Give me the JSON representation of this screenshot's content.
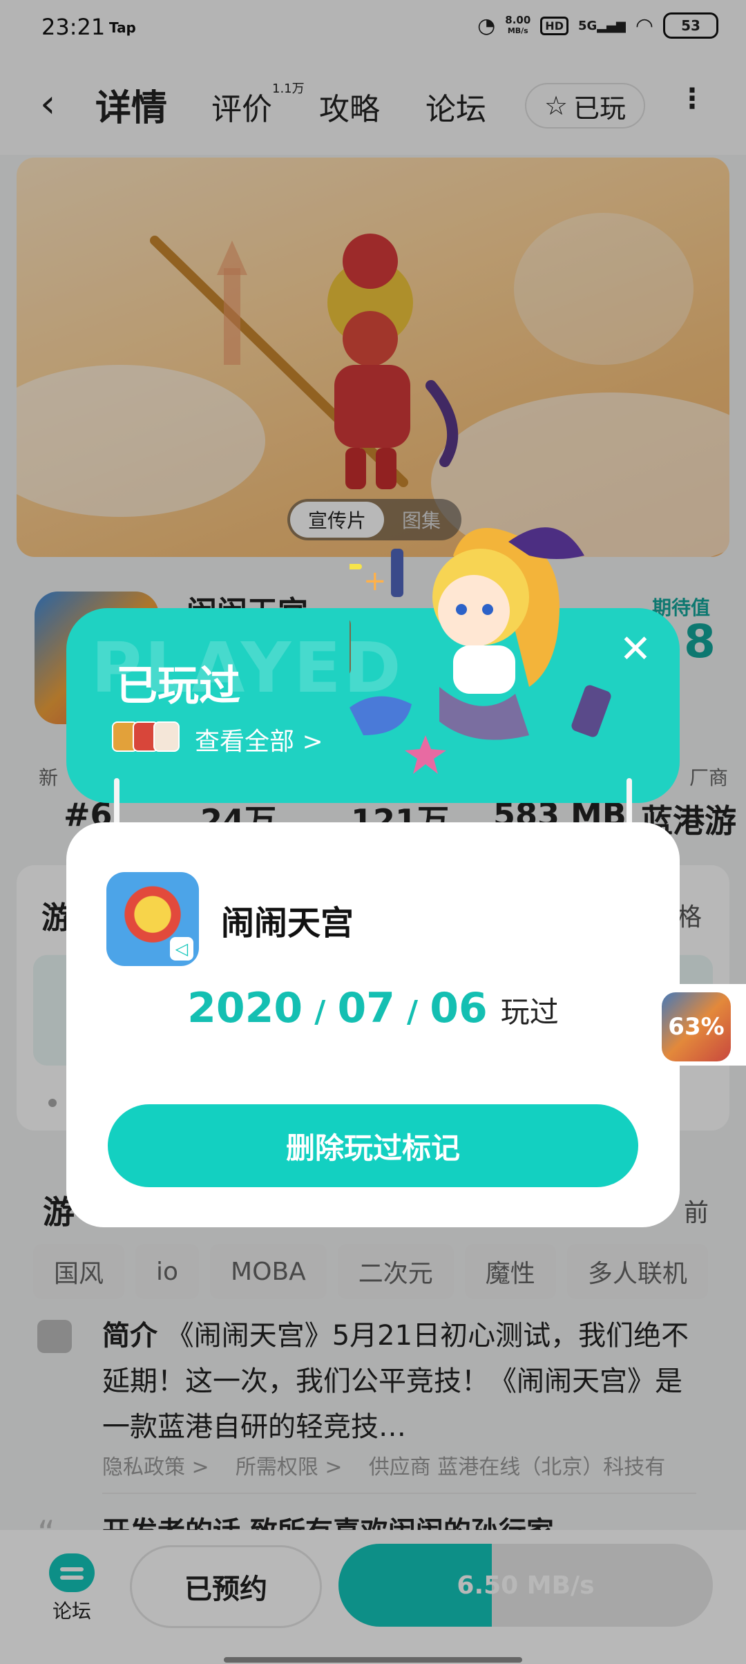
{
  "status_bar": {
    "time": "23:21",
    "tap_label": "Tap",
    "net_speed_value": "8.00",
    "net_speed_unit": "MB/s",
    "hd_label": "HD",
    "network": "5G",
    "battery": "53"
  },
  "nav": {
    "tabs": [
      {
        "label": "详情",
        "active": true
      },
      {
        "label": "评价",
        "badge": "1.1万"
      },
      {
        "label": "攻略"
      },
      {
        "label": "论坛"
      }
    ],
    "played_label": "已玩"
  },
  "hero": {
    "toggle_active": "宣传片",
    "toggle_inactive": "图集"
  },
  "game": {
    "title": "闹闹天宫",
    "expect_label": "期待值",
    "expect_value": "8",
    "stats": [
      {
        "label": "新",
        "value": "#6"
      },
      {
        "label": "",
        "value": "24万"
      },
      {
        "label": "",
        "value": "121万"
      },
      {
        "label": "",
        "value": "583 MB"
      },
      {
        "label": "厂商",
        "value": "蓝港游"
      }
    ]
  },
  "section1": {
    "title": "游",
    "right": "格"
  },
  "section2": {
    "title": "游",
    "right": "前"
  },
  "tags": [
    "国风",
    "io",
    "MOBA",
    "二次元",
    "魔性",
    "多人联机"
  ],
  "intro": {
    "label": "简介",
    "text": "《闹闹天宫》5月21日初心测试，我们绝不延期！这一次，我们公平竞技！《闹闹天宫》是一款蓝港自研的轻竞技…"
  },
  "links": [
    "隐私政策 >",
    "所需权限 >",
    "供应商 蓝港在线（北京）科技有"
  ],
  "dev_words": "开发者的话 致所有喜欢闹闹的孙行家",
  "bottom": {
    "forum_label": "论坛",
    "reserved_label": "已预约",
    "download_text": "6.50 MB/s",
    "download_progress": 0.41
  },
  "played_dialog": {
    "watermark": "PLAYED",
    "title": "已玩过",
    "view_all": "查看全部 >",
    "game_name": "闹闹天宫",
    "year": "2020",
    "month": "07",
    "day": "06",
    "date_sep": "/",
    "played_suffix": "玩过",
    "delete_label": "删除玩过标记",
    "close_icon": "close-icon"
  },
  "floating_download": {
    "progress_text": "63%"
  },
  "colors": {
    "accent": "#12c6bb",
    "date": "#14bfb2"
  }
}
